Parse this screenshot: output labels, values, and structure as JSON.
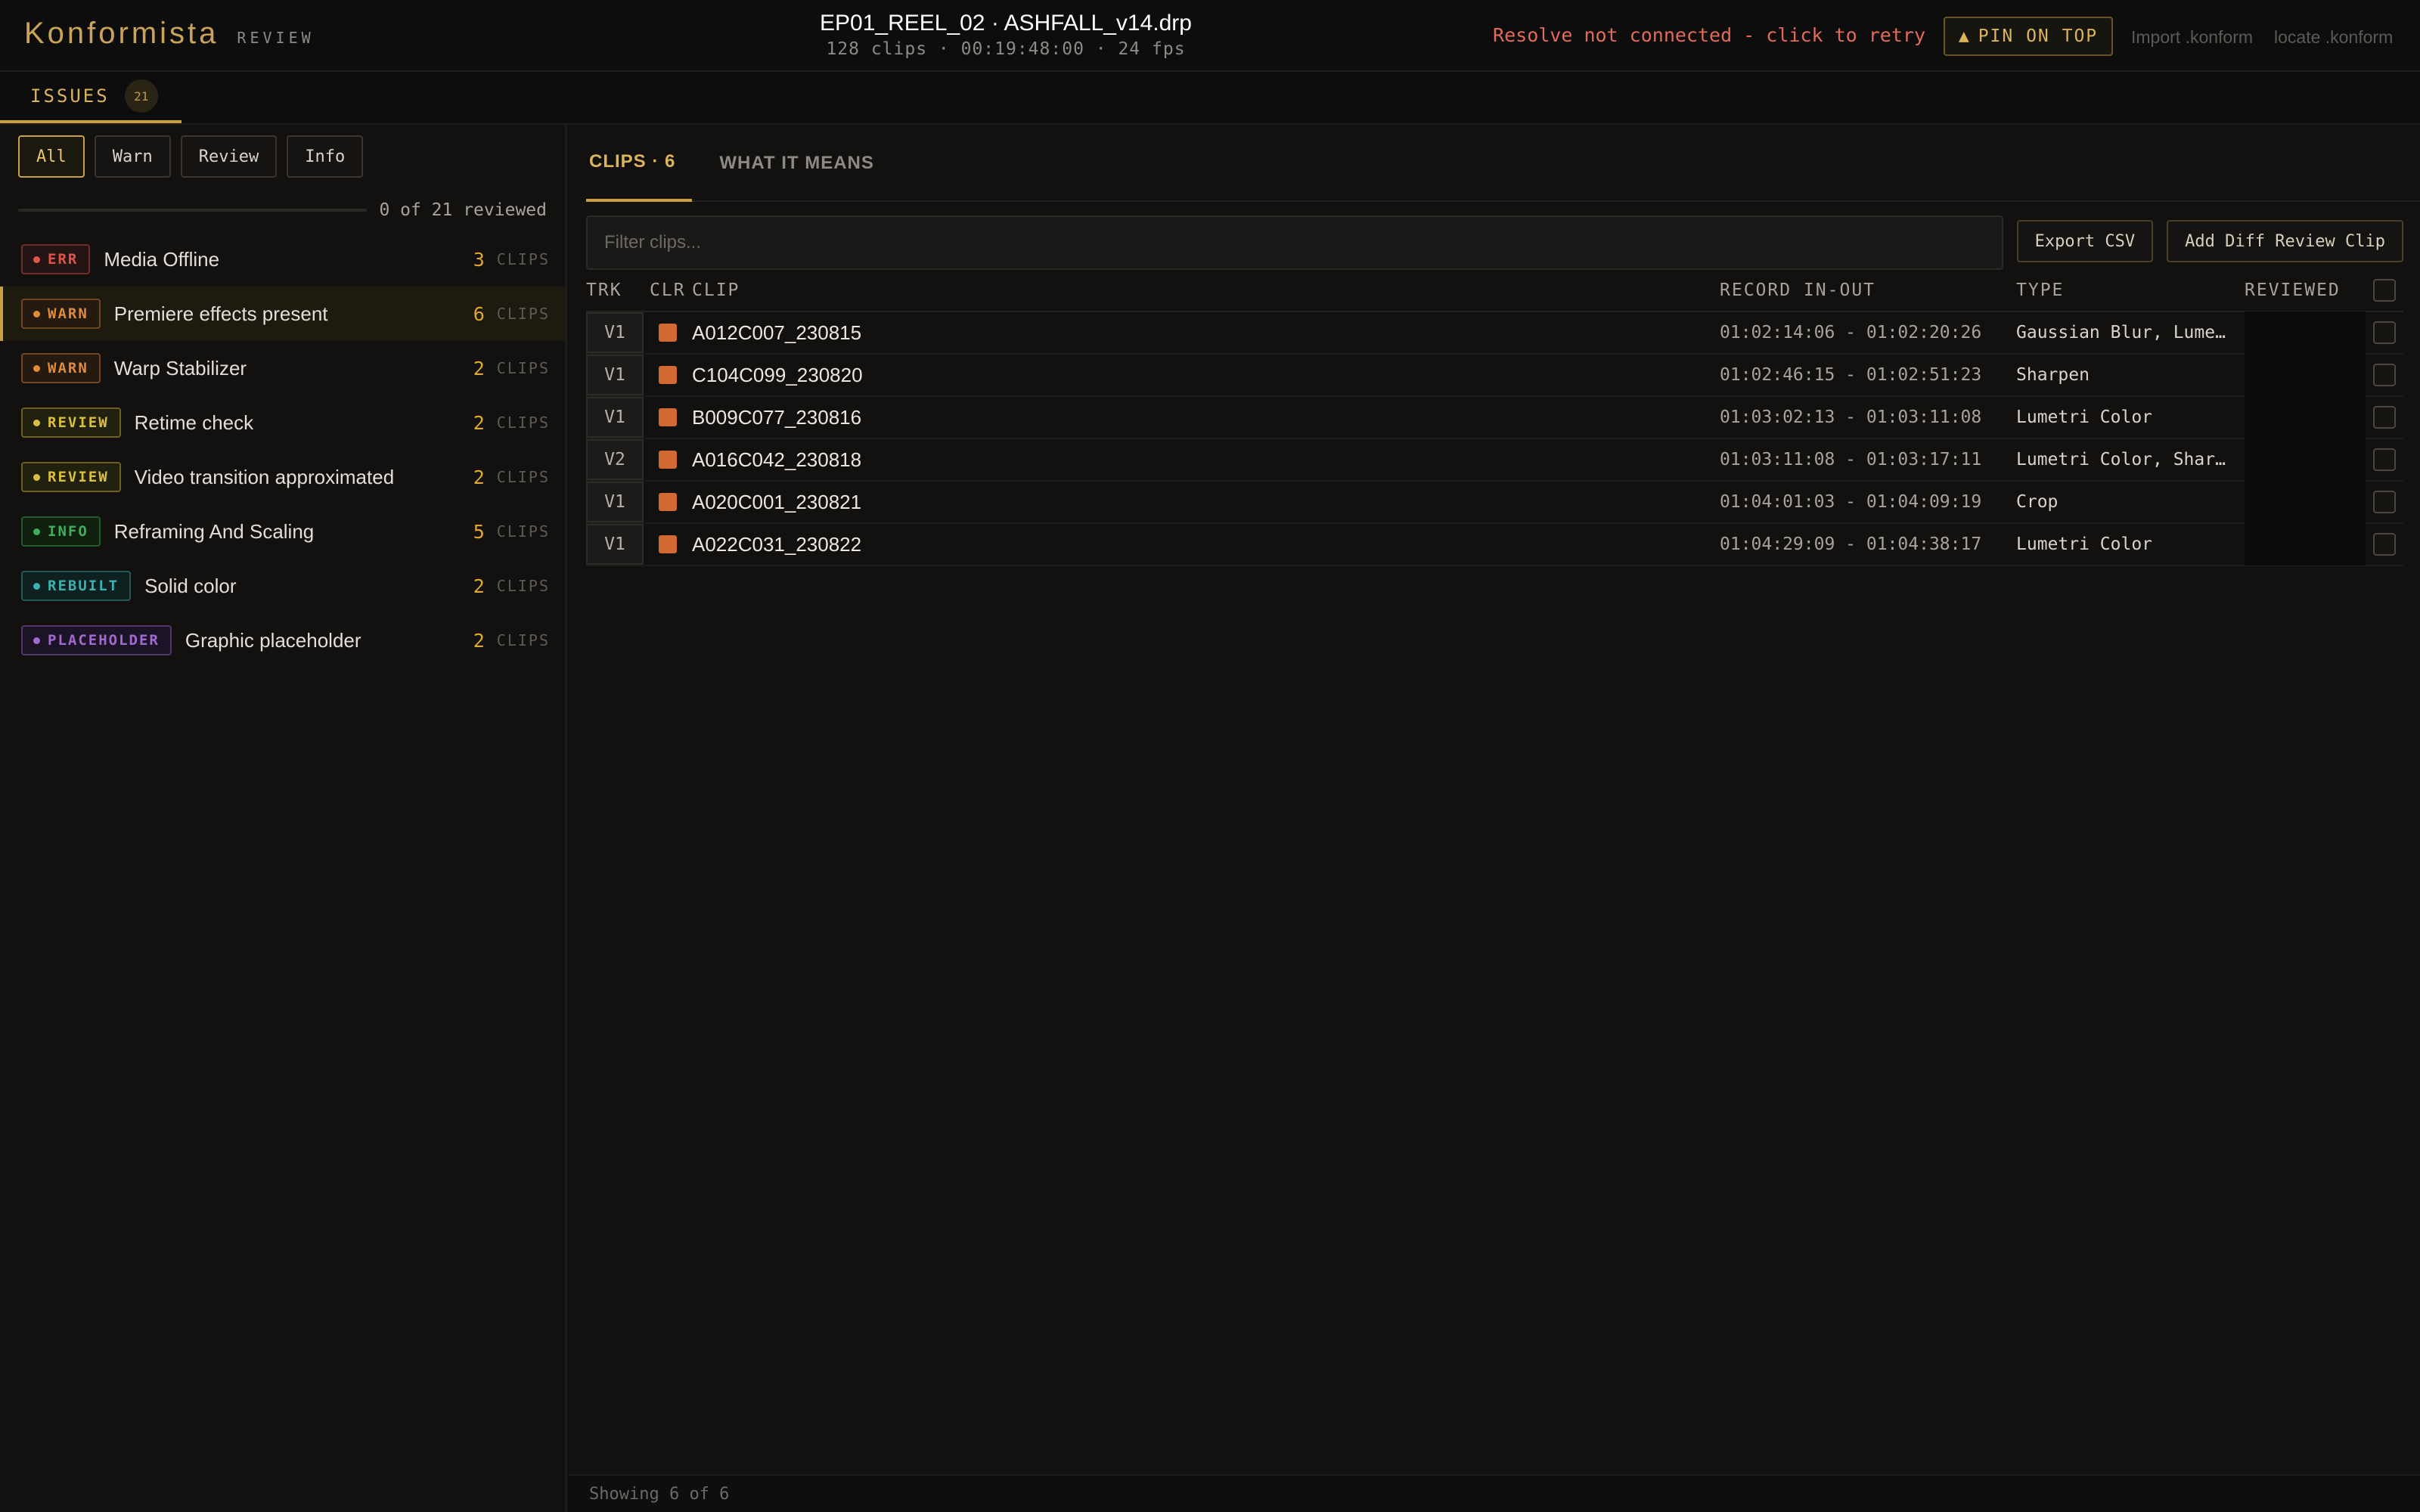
{
  "app": {
    "brand": "Konformista",
    "brand_sub": "REVIEW"
  },
  "file": {
    "title": "EP01_REEL_02 · ASHFALL_v14.drp",
    "meta": "128 clips · 00:19:48:00 · 24 fps"
  },
  "header": {
    "resolve_status": "Resolve not connected - click to retry",
    "pin_icon": "▲",
    "pin_label": "PIN ON TOP",
    "import_link": "Import .konform",
    "locate_link": "locate .konform"
  },
  "issues_tab": {
    "label": "ISSUES",
    "count": "21"
  },
  "filters": [
    {
      "label": "All",
      "active": true
    },
    {
      "label": "Warn",
      "active": false
    },
    {
      "label": "Review",
      "active": false
    },
    {
      "label": "Info",
      "active": false
    }
  ],
  "progress": {
    "text": "0 of 21 reviewed",
    "fraction": 0
  },
  "issues": [
    {
      "badge": "ERR",
      "title": "Media Offline",
      "count": "3",
      "unit": "CLIPS",
      "color": "#e0554a",
      "bg": "#241414",
      "selected": false
    },
    {
      "badge": "WARN",
      "title": "Premiere effects present",
      "count": "6",
      "unit": "CLIPS",
      "color": "#e08a3c",
      "bg": "#241a10",
      "selected": true
    },
    {
      "badge": "WARN",
      "title": "Warp Stabilizer",
      "count": "2",
      "unit": "CLIPS",
      "color": "#e08a3c",
      "bg": "#241a10",
      "selected": false
    },
    {
      "badge": "REVIEW",
      "title": "Retime check",
      "count": "2",
      "unit": "CLIPS",
      "color": "#d9c040",
      "bg": "#22200e",
      "selected": false
    },
    {
      "badge": "REVIEW",
      "title": "Video transition approximated",
      "count": "2",
      "unit": "CLIPS",
      "color": "#d9c040",
      "bg": "#22200e",
      "selected": false
    },
    {
      "badge": "INFO",
      "title": "Reframing And Scaling",
      "count": "5",
      "unit": "CLIPS",
      "color": "#3fae5a",
      "bg": "#10200f",
      "selected": false
    },
    {
      "badge": "REBUILT",
      "title": "Solid color",
      "count": "2",
      "unit": "CLIPS",
      "color": "#3eb0b0",
      "bg": "#0f2020",
      "selected": false
    },
    {
      "badge": "PLACEHOLDER",
      "title": "Graphic placeholder",
      "count": "2",
      "unit": "CLIPS",
      "color": "#a06ad0",
      "bg": "#1c1426",
      "selected": false
    }
  ],
  "main_tabs": [
    {
      "label": "CLIPS · 6",
      "active": true
    },
    {
      "label": "WHAT IT MEANS",
      "active": false
    }
  ],
  "toolbar": {
    "filter_placeholder": "Filter clips...",
    "export_label": "Export CSV",
    "add_diff_label": "Add Diff Review Clip"
  },
  "table": {
    "headers": {
      "trk": "TRK",
      "clr": "CLR",
      "clip": "CLIP",
      "record": "RECORD IN-OUT",
      "type": "TYPE",
      "reviewed": "REVIEWED"
    },
    "rows": [
      {
        "trk": "V1",
        "color": "#d06a30",
        "clip": "A012C007_230815",
        "record": "01:02:14:06 - 01:02:20:26",
        "type": "Gaussian Blur, Lumetri Color"
      },
      {
        "trk": "V1",
        "color": "#d06a30",
        "clip": "C104C099_230820",
        "record": "01:02:46:15 - 01:02:51:23",
        "type": "Sharpen"
      },
      {
        "trk": "V1",
        "color": "#d06a30",
        "clip": "B009C077_230816",
        "record": "01:03:02:13 - 01:03:11:08",
        "type": "Lumetri Color"
      },
      {
        "trk": "V2",
        "color": "#d06a30",
        "clip": "A016C042_230818",
        "record": "01:03:11:08 - 01:03:17:11",
        "type": "Lumetri Color, Sharpen"
      },
      {
        "trk": "V1",
        "color": "#d06a30",
        "clip": "A020C001_230821",
        "record": "01:04:01:03 - 01:04:09:19",
        "type": "Crop"
      },
      {
        "trk": "V1",
        "color": "#d06a30",
        "clip": "A022C031_230822",
        "record": "01:04:29:09 - 01:04:38:17",
        "type": "Lumetri Color"
      }
    ]
  },
  "footer": {
    "text": "Showing 6 of 6"
  }
}
